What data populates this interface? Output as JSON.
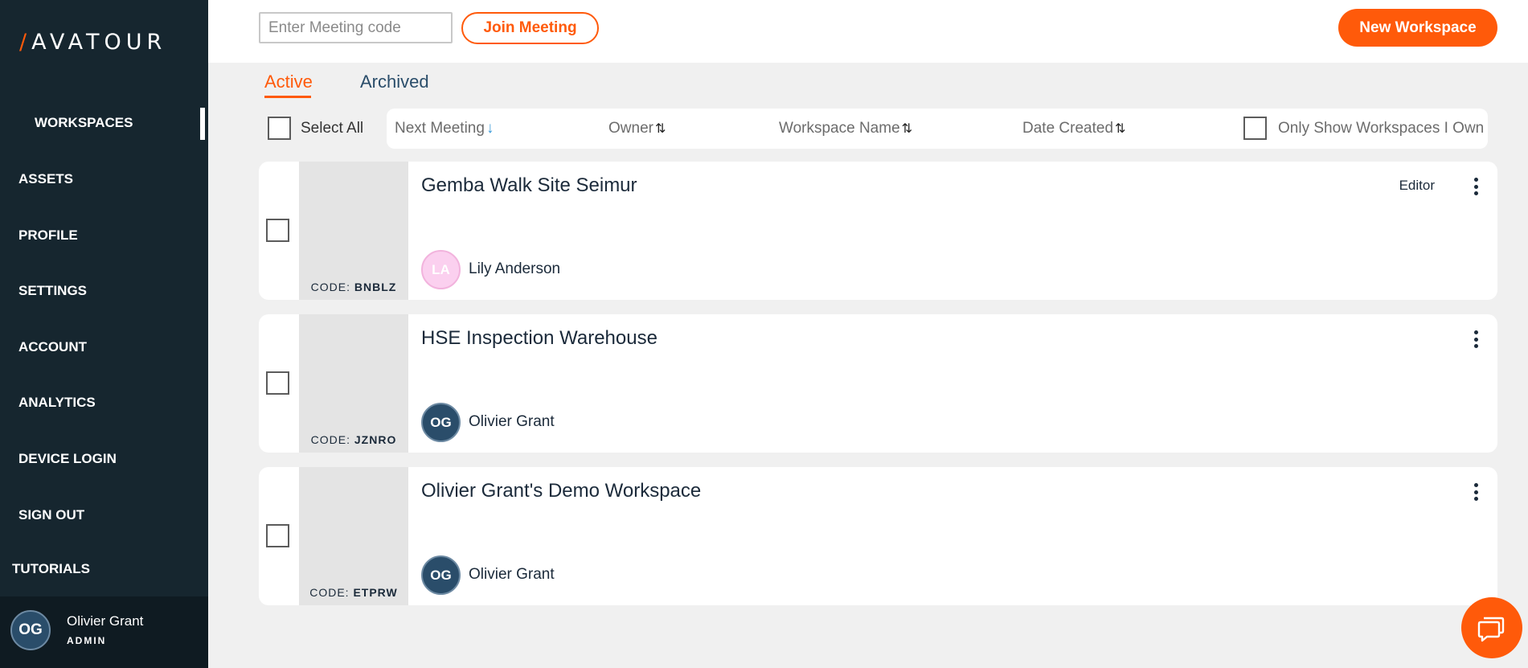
{
  "brand": {
    "logo_text": "AVATOUR",
    "accent": "#ff5a0a",
    "sidebar_bg": "#16262f"
  },
  "sidebar": {
    "items": [
      {
        "label": "WORKSPACES",
        "active": true
      },
      {
        "label": "ASSETS"
      },
      {
        "label": "PROFILE"
      },
      {
        "label": "SETTINGS"
      },
      {
        "label": "ACCOUNT"
      },
      {
        "label": "ANALYTICS"
      },
      {
        "label": "DEVICE LOGIN"
      },
      {
        "label": "SIGN OUT"
      },
      {
        "label": "TUTORIALS"
      }
    ],
    "user": {
      "initials": "OG",
      "name": "Olivier Grant",
      "role": "ADMIN"
    }
  },
  "topbar": {
    "meeting_code_placeholder": "Enter Meeting code",
    "join_label": "Join Meeting",
    "new_workspace_label": "New Workspace"
  },
  "tabs": [
    {
      "label": "Active",
      "active": true
    },
    {
      "label": "Archived"
    }
  ],
  "filters": {
    "select_all_label": "Select All",
    "sort_columns": [
      {
        "label": "Next Meeting",
        "arrow": "↓",
        "active": true
      },
      {
        "label": "Owner",
        "arrow": "⇅"
      },
      {
        "label": "Workspace Name",
        "arrow": "⇅"
      },
      {
        "label": "Date Created",
        "arrow": "⇅"
      }
    ],
    "only_own_label": "Only Show Workspaces I Own"
  },
  "workspaces": [
    {
      "title": "Gemba Walk Site Seimur",
      "code_prefix": "CODE:",
      "code": "BNBLZ",
      "role": "Editor",
      "owner_initials": "LA",
      "owner_name": "Lily Anderson",
      "owner_color": "pink"
    },
    {
      "title": "HSE Inspection Warehouse",
      "code_prefix": "CODE:",
      "code": "JZNRO",
      "role": "",
      "owner_initials": "OG",
      "owner_name": "Olivier Grant",
      "owner_color": "dark"
    },
    {
      "title": "Olivier Grant's Demo Workspace",
      "code_prefix": "CODE:",
      "code": "ETPRW",
      "role": "",
      "owner_initials": "OG",
      "owner_name": "Olivier Grant",
      "owner_color": "dark"
    }
  ],
  "chat": {
    "icon": "chat-bubble-icon"
  }
}
